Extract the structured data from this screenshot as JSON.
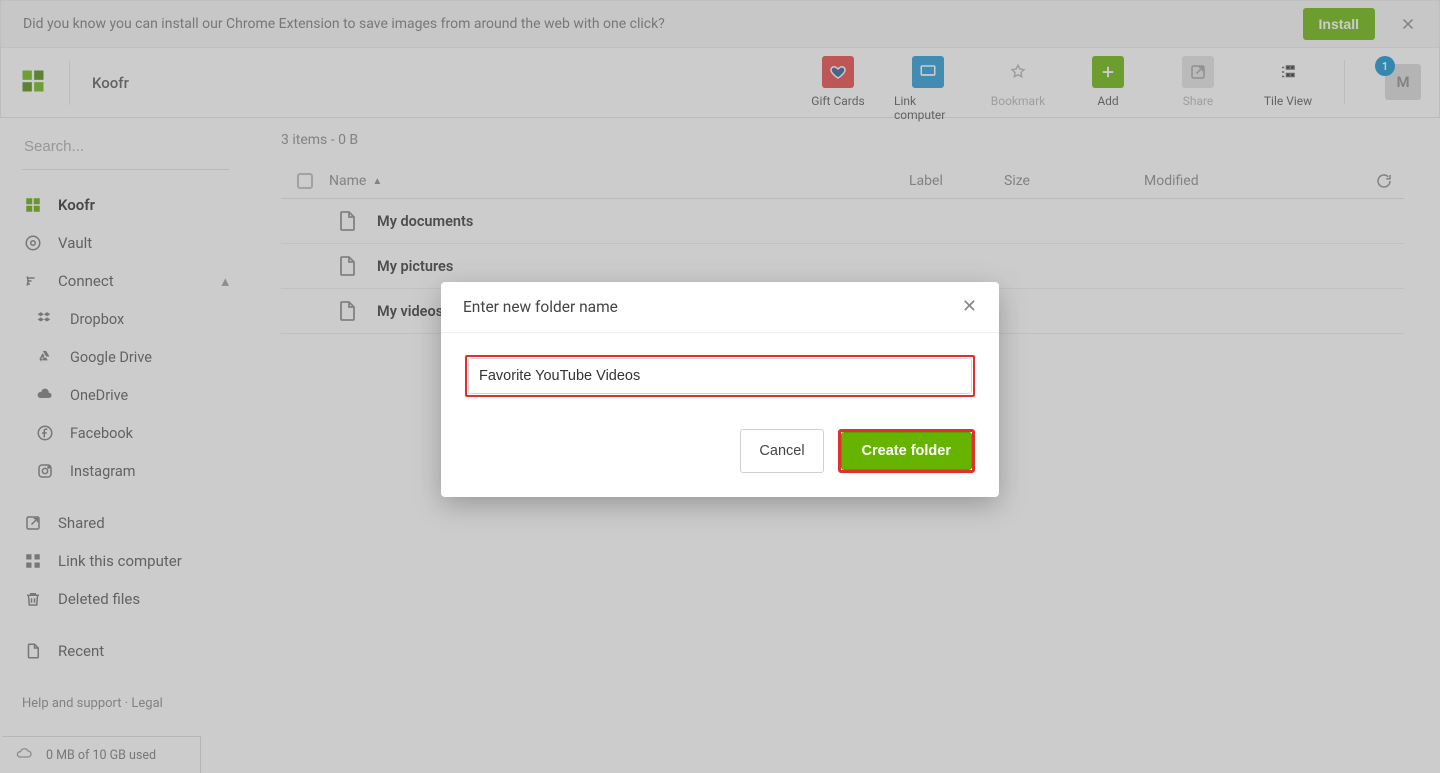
{
  "banner": {
    "text": "Did you know you can install our Chrome Extension to save images from around the web with one click?",
    "install_label": "Install"
  },
  "brand": "Koofr",
  "top_actions": {
    "gift_cards": "Gift Cards",
    "link_computer": "Link computer",
    "bookmark": "Bookmark",
    "add": "Add",
    "share": "Share",
    "tile_view": "Tile View"
  },
  "avatar": {
    "initial": "M",
    "badge": "1"
  },
  "search": {
    "placeholder": "Search..."
  },
  "sidebar": {
    "koofr": "Koofr",
    "vault": "Vault",
    "connect": "Connect",
    "dropbox": "Dropbox",
    "google_drive": "Google Drive",
    "onedrive": "OneDrive",
    "facebook": "Facebook",
    "instagram": "Instagram",
    "shared": "Shared",
    "link_this_computer": "Link this computer",
    "deleted_files": "Deleted files",
    "recent": "Recent"
  },
  "footer": {
    "help": "Help and support",
    "sep": " · ",
    "legal": "Legal"
  },
  "summary": "3 items - 0 B",
  "columns": {
    "name": "Name",
    "label": "Label",
    "size": "Size",
    "modified": "Modified"
  },
  "rows": [
    {
      "name": "My documents"
    },
    {
      "name": "My pictures"
    },
    {
      "name": "My videos"
    }
  ],
  "storage": "0 MB of 10 GB used",
  "modal": {
    "title": "Enter new folder name",
    "value": "Favorite YouTube Videos",
    "cancel": "Cancel",
    "create": "Create folder"
  }
}
